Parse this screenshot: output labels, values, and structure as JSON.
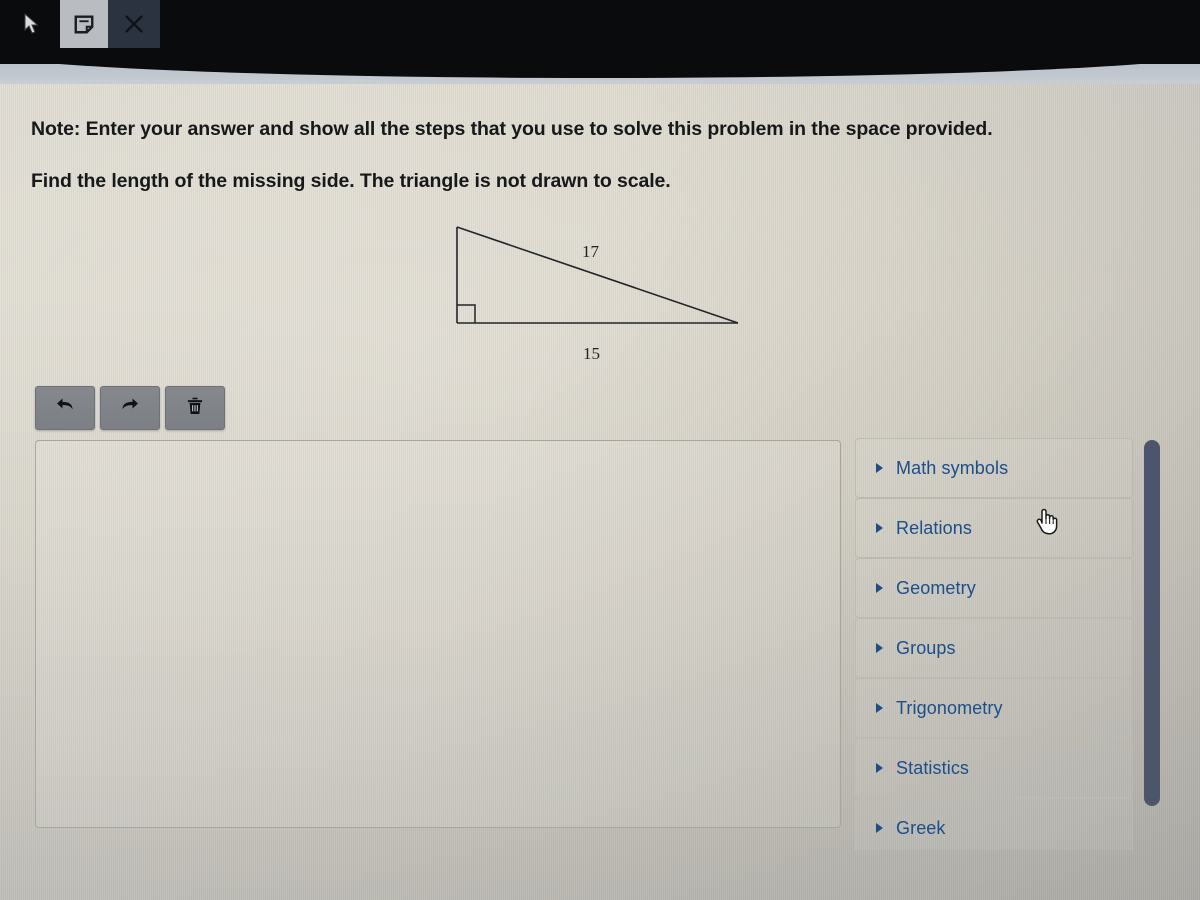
{
  "os_bar": {
    "cursor_icon": "arrow-cursor-icon",
    "snip_icon": "snip-note-icon",
    "close_icon": "close-x-icon"
  },
  "prompt": {
    "note": "Note: Enter your answer and show all the steps that you use to solve this problem in the space provided.",
    "instruction": "Find the length of the missing side. The triangle is not drawn to scale."
  },
  "figure": {
    "type": "right-triangle",
    "hypotenuse_label": "17",
    "base_label": "15",
    "right_angle_marker": true,
    "stroke_color": "#1e2023"
  },
  "toolbar": {
    "buttons": [
      {
        "name": "undo-button",
        "icon": "undo-arrow-icon"
      },
      {
        "name": "redo-button",
        "icon": "redo-arrow-icon"
      },
      {
        "name": "delete-button",
        "icon": "trash-can-icon"
      }
    ]
  },
  "answer_area": {
    "value": "",
    "placeholder": ""
  },
  "palette": {
    "accent_color": "#1c4e8a",
    "items": [
      {
        "label": "Math symbols"
      },
      {
        "label": "Relations"
      },
      {
        "label": "Geometry"
      },
      {
        "label": "Groups"
      },
      {
        "label": "Trigonometry"
      },
      {
        "label": "Statistics"
      },
      {
        "label": "Greek"
      }
    ],
    "scrollbar": {
      "color": "#4c556a"
    }
  },
  "pointer": {
    "icon": "hand-pointer-cursor",
    "near_item": "Relations"
  }
}
